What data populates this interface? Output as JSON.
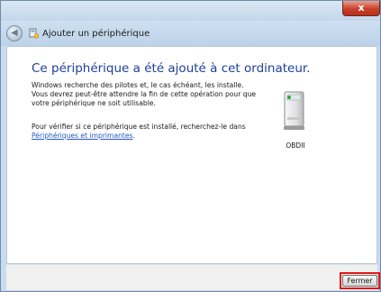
{
  "window": {
    "close_label": "x",
    "title": "Ajouter un périphérique"
  },
  "main": {
    "heading": "Ce périphérique a été ajouté à cet ordinateur.",
    "paragraph1": "Windows recherche des pilotes et, le cas échéant, les installe. Vous devrez peut-être attendre la fin de cette opération pour que votre périphérique ne soit utilisable.",
    "paragraph2_prefix": "Pour vérifier si ce périphérique est installé, recherchez-le dans",
    "paragraph2_link": "Périphériques et imprimantes",
    "paragraph2_suffix": "."
  },
  "device": {
    "label": "OBDII",
    "icon": "printer-device-icon"
  },
  "footer": {
    "close_button_label": "Fermer"
  },
  "colors": {
    "heading": "#1e3f9b",
    "link": "#2257c6",
    "highlight_box": "#e01818"
  }
}
